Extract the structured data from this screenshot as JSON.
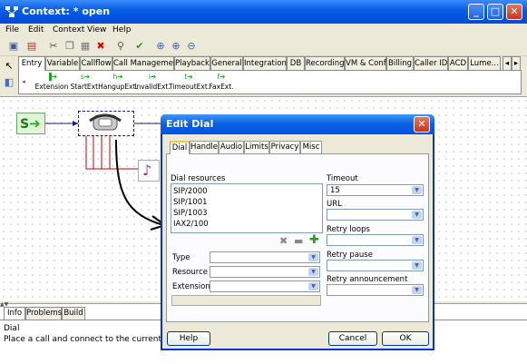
{
  "window": {
    "title": "Context: * open"
  },
  "menu": [
    "File",
    "Edit",
    "Context",
    "View",
    "Help"
  ],
  "palette": {
    "tabs": [
      "Entry",
      "Variable",
      "Callflow",
      "Call Management",
      "Playback",
      "General",
      "Integration",
      "DB",
      "Recording",
      "VM & Conf",
      "Billing",
      "Caller ID",
      "ACD",
      "Lume..."
    ],
    "active_tab": "Entry",
    "items": [
      "Extension",
      "StartExt.",
      "HangupExt.",
      "InvalidExt.",
      "TimeoutExt.",
      "FaxExt."
    ]
  },
  "canvas": {
    "start_label": "S"
  },
  "dialog": {
    "title": "Edit Dial",
    "tabs": [
      "Dial",
      "Handle",
      "Audio",
      "Limits",
      "Privacy",
      "Misc"
    ],
    "active_tab": "Dial",
    "resources_label": "Dial resources",
    "resources": [
      "SIP/2000",
      "SIP/1001",
      "SIP/1003",
      "IAX2/100"
    ],
    "type_label": "Type",
    "resource_label": "Resource",
    "extension_label": "Extension",
    "timeout_label": "Timeout",
    "timeout_value": "15",
    "url_label": "URL",
    "url_value": "",
    "retry_loops_label": "Retry loops",
    "retry_pause_label": "Retry pause",
    "retry_announcement_label": "Retry announcement",
    "help_button": "Help",
    "cancel_button": "Cancel",
    "ok_button": "OK"
  },
  "info": {
    "tabs": [
      "Info",
      "Problems",
      "Build"
    ],
    "active_tab": "Info",
    "title": "Dial",
    "description": "Place a call and connect to the current channel"
  }
}
